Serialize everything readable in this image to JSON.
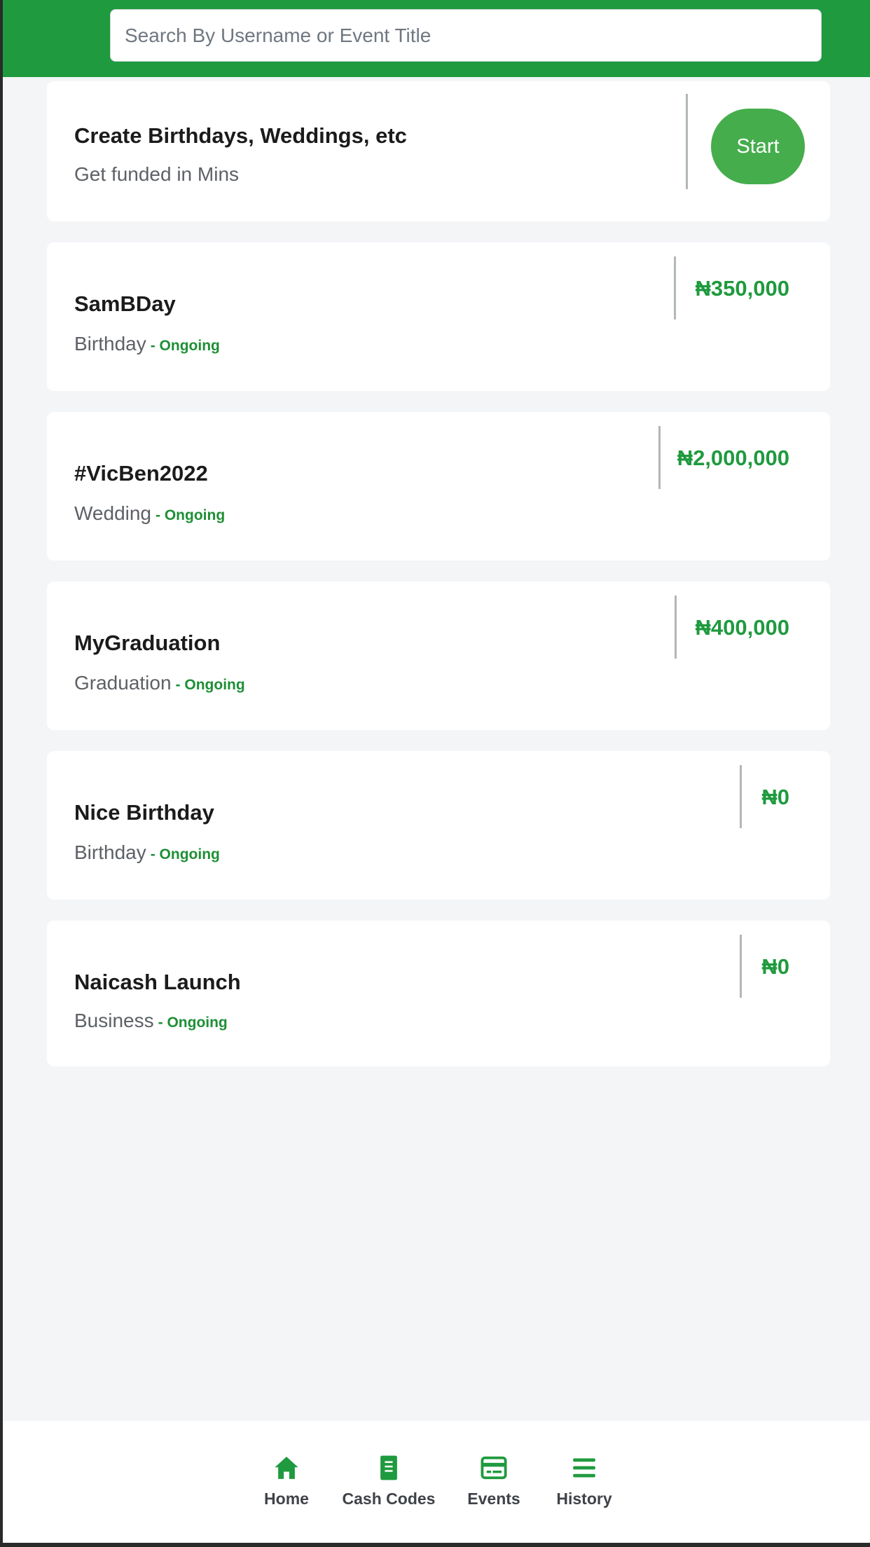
{
  "search": {
    "placeholder": "Search By Username or Event Title"
  },
  "create_card": {
    "title": "Create Birthdays, Weddings, etc",
    "subtitle": "Get funded in Mins",
    "button_label": "Start"
  },
  "events": [
    {
      "title": "SamBDay",
      "type": "Birthday",
      "status": "- Ongoing",
      "amount": "₦350,000"
    },
    {
      "title": "#VicBen2022",
      "type": "Wedding",
      "status": "- Ongoing",
      "amount": "₦2,000,000"
    },
    {
      "title": "MyGraduation",
      "type": "Graduation",
      "status": "- Ongoing",
      "amount": "₦400,000"
    },
    {
      "title": "Nice Birthday",
      "type": "Birthday",
      "status": "- Ongoing",
      "amount": "₦0"
    },
    {
      "title": "Naicash Launch",
      "type": "Business",
      "status": "- Ongoing",
      "amount": "₦0"
    }
  ],
  "nav": {
    "items": [
      {
        "label": "Home",
        "icon": "home-icon"
      },
      {
        "label": "Cash Codes",
        "icon": "receipt-icon"
      },
      {
        "label": "Events",
        "icon": "card-icon"
      },
      {
        "label": "History",
        "icon": "list-icon"
      }
    ]
  },
  "colors": {
    "brand_green": "#1f9a3e",
    "button_green": "#45ad4c",
    "status_green": "#1e8f35",
    "background": "#f4f5f7"
  }
}
